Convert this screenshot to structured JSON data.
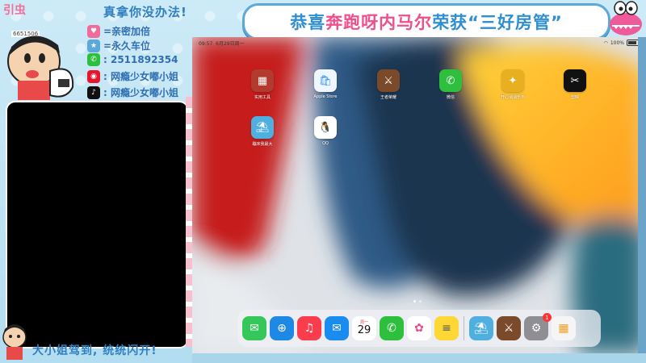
{
  "banner": {
    "part1": "恭喜",
    "part2": "奔跑呀内马尔",
    "part3": "荣获“三好房管”"
  },
  "info_panel": {
    "brand": "引虫",
    "title": "真拿你没办法!",
    "id_tag": "6651506",
    "rows": [
      {
        "icon": "heart-badge-icon",
        "text": "=亲密加倍"
      },
      {
        "icon": "car-badge-icon",
        "text": "=永久车位"
      },
      {
        "icon": "wechat-icon",
        "text": ": 2511892354"
      },
      {
        "icon": "weibo-icon",
        "text": ": 网瘾少女嘟小姐"
      },
      {
        "icon": "tiktok-icon",
        "text": ": 网瘾少女嘟小姐"
      }
    ]
  },
  "bottom_caption": "大小姐驾到, 统统闪开!",
  "ipad": {
    "status": {
      "time": "09:57",
      "date": "6月29日周一",
      "battery": "100%"
    },
    "apps": [
      {
        "label": "实用工具",
        "icon": "folder-icon",
        "color": "#b33a2f"
      },
      {
        "label": "Apple Store",
        "icon": "apple-store-icon",
        "color": "#2a8ef0"
      },
      {
        "label": "王者荣耀",
        "icon": "game-honor-icon",
        "color": "#7a4a2a"
      },
      {
        "label": "微信",
        "icon": "wechat-icon",
        "color": "#2fbf3f"
      },
      {
        "label": "开心消消乐®",
        "icon": "game-match-icon",
        "color": "#e8b020"
      },
      {
        "label": "剪映",
        "icon": "capcut-icon",
        "color": "#111111"
      },
      {
        "label": "蹦床我最大",
        "icon": "game-beach-icon",
        "color": "#4fb0e0"
      },
      {
        "label": "QQ",
        "icon": "qq-icon",
        "color": "#ffffff"
      }
    ],
    "dock": [
      {
        "name": "messages-icon",
        "glyph": "💬",
        "color": "#35c759"
      },
      {
        "name": "safari-icon",
        "glyph": "🧭",
        "color": "#1e88e5"
      },
      {
        "name": "music-icon",
        "glyph": "♫",
        "color": "#fa3c4c"
      },
      {
        "name": "mail-icon",
        "glyph": "✉",
        "color": "#1a8cf0"
      },
      {
        "name": "calendar-icon",
        "glyph": "29",
        "color": "#ffffff",
        "caption": "周一"
      },
      {
        "name": "wechat-icon",
        "glyph": "✆",
        "color": "#2fbf3f"
      },
      {
        "name": "photos-icon",
        "glyph": "✿",
        "color": "#ffffff"
      },
      {
        "name": "notes-icon",
        "glyph": "≡",
        "color": "#fdd835"
      },
      {
        "name": "game-beach-icon",
        "glyph": "⛱",
        "color": "#4fb0e0"
      },
      {
        "name": "game-honor-icon",
        "glyph": "⚔",
        "color": "#7a4a2a"
      },
      {
        "name": "settings-icon",
        "glyph": "⚙",
        "color": "#8e8e93",
        "badge": "1"
      },
      {
        "name": "app-library-icon",
        "glyph": "▦",
        "color": "#f5f5f5"
      }
    ]
  }
}
